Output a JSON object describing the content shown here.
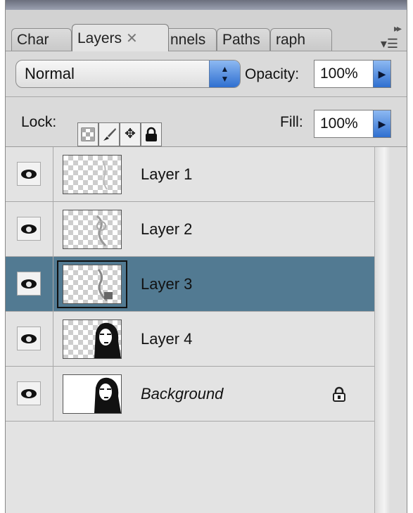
{
  "tabs": [
    {
      "label": "Char",
      "active": false
    },
    {
      "label": "Layers",
      "active": true
    },
    {
      "label": "nnels",
      "active": false
    },
    {
      "label": "Paths",
      "active": false
    },
    {
      "label": "raph",
      "active": false
    }
  ],
  "blend_mode": {
    "value": "Normal"
  },
  "opacity": {
    "label": "Opacity:",
    "value": "100%"
  },
  "lock": {
    "label": "Lock:"
  },
  "fill": {
    "label": "Fill:",
    "value": "100%"
  },
  "layers": [
    {
      "name": "Layer 1",
      "visible": true,
      "selected": false,
      "locked": false,
      "italic": false
    },
    {
      "name": "Layer 2",
      "visible": true,
      "selected": false,
      "locked": false,
      "italic": false
    },
    {
      "name": "Layer 3",
      "visible": true,
      "selected": true,
      "locked": false,
      "italic": false
    },
    {
      "name": "Layer 4",
      "visible": true,
      "selected": false,
      "locked": false,
      "italic": false
    },
    {
      "name": "Background",
      "visible": true,
      "selected": false,
      "locked": true,
      "italic": true
    }
  ],
  "colors": {
    "selected_row": "#527a92",
    "accent_button": "#2f6fd0"
  },
  "icons": [
    "panel-collapse-icon",
    "panel-menu-icon",
    "eye-icon",
    "padlock-icon",
    "lock-transparency-icon",
    "lock-paint-icon",
    "lock-move-icon",
    "lock-all-icon"
  ]
}
